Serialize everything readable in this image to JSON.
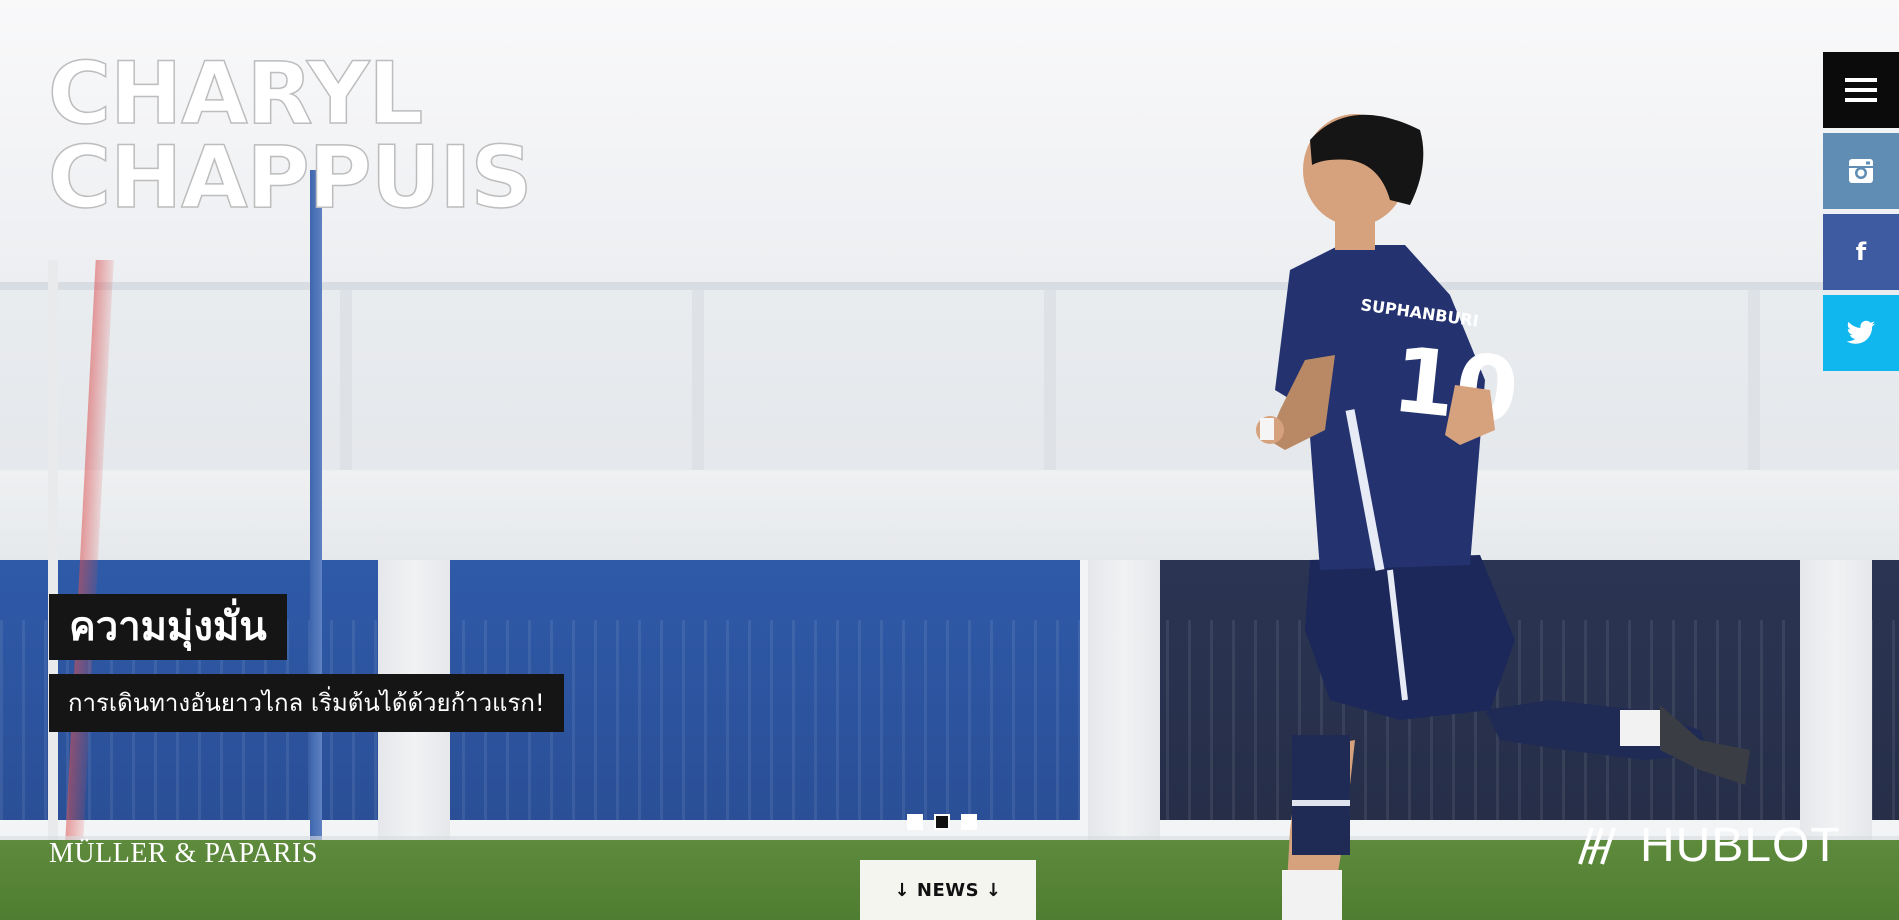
{
  "site": {
    "title_line1": "CHARYL",
    "title_line2": "CHAPPUIS"
  },
  "social": {
    "menu_icon": "hamburger-icon",
    "instagram_icon": "instagram-icon",
    "facebook_icon": "facebook-icon",
    "twitter_icon": "twitter-icon",
    "colors": {
      "menu": "#0b0b0b",
      "instagram": "#5f8db3",
      "facebook": "#3e5aa0",
      "twitter": "#10b6ee"
    }
  },
  "slide": {
    "caption_title": "ความมุ่งมั่น",
    "caption_subtitle": "การเดินทางอันยาวไกล เริ่มต้นได้ด้วยก้าวแรก!",
    "player_jersey_text": "SUPHANBURI",
    "player_number": "10"
  },
  "slider": {
    "count": 3,
    "active_index": 1
  },
  "sponsors": {
    "left": "MÜLLER & PAPARIS",
    "right": "HUBLOT"
  },
  "news_tab": {
    "label": "↓ NEWS ↓"
  }
}
